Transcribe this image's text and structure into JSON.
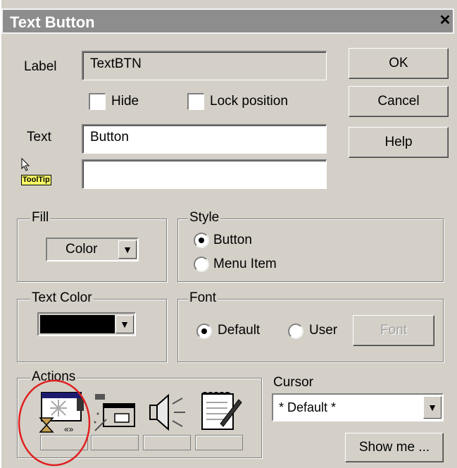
{
  "window": {
    "title": "Text Button",
    "close": "✕"
  },
  "label_row": {
    "label": "Label",
    "value": "TextBTN"
  },
  "options": {
    "hide": "Hide",
    "lock_position": "Lock position"
  },
  "text_row": {
    "label": "Text",
    "value": "Button"
  },
  "tooltip_row": {
    "badge": "ToolTip",
    "value": ""
  },
  "buttons": {
    "ok": "OK",
    "cancel": "Cancel",
    "help": "Help",
    "font": "Font",
    "show_me": "Show me ..."
  },
  "fill": {
    "title": "Fill",
    "selected": "Color"
  },
  "style": {
    "title": "Style",
    "button": "Button",
    "menu_item": "Menu Item",
    "selected": "Button"
  },
  "text_color": {
    "title": "Text Color",
    "color": "#000000"
  },
  "font_group": {
    "title": "Font",
    "default": "Default",
    "user": "User",
    "selected": "Default"
  },
  "actions": {
    "title": "Actions",
    "icons": [
      "hourglass-action-icon",
      "window-action-icon",
      "speaker-icon",
      "notepad-pen-icon"
    ]
  },
  "cursor": {
    "title": "Cursor",
    "selected": "* Default *"
  },
  "annotation": {
    "color": "#e02020"
  }
}
